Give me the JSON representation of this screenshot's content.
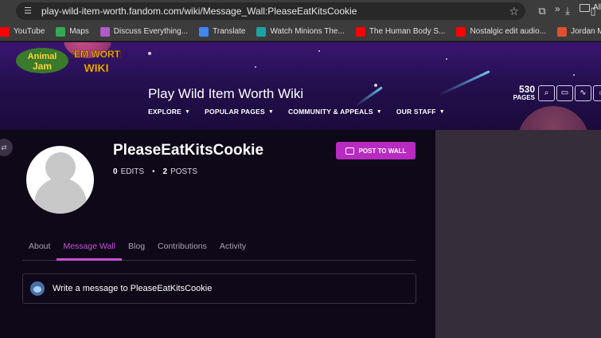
{
  "browser": {
    "url": "play-wild-item-worth.fandom.com/wiki/Message_Wall:PleaseEatKitsCookie",
    "bookmarks": [
      {
        "label": "YouTube",
        "color": "#ff0000"
      },
      {
        "label": "Maps",
        "color": "#34a853"
      },
      {
        "label": "Discuss Everything...",
        "color": "#b05cc8"
      },
      {
        "label": "Translate",
        "color": "#4285f4"
      },
      {
        "label": "Watch Minions The...",
        "color": "#1aa3a3"
      },
      {
        "label": "The Human Body S...",
        "color": "#ff0000"
      },
      {
        "label": "Nostalgic edit audio...",
        "color": "#ff0000"
      },
      {
        "label": "Jordan Marsh's Blue...",
        "color": "#e0502e"
      }
    ],
    "bookmarks_all": "All"
  },
  "wiki": {
    "title": "Play Wild Item Worth Wiki",
    "logo_text": "ITEM WORTH WIKI",
    "nav": [
      "EXPLORE",
      "POPULAR PAGES",
      "COMMUNITY & APPEALS",
      "OUR STAFF"
    ],
    "pages_count": "530",
    "pages_label": "PAGES"
  },
  "profile": {
    "username": "PleaseEatKitsCookie",
    "edits_count": "0",
    "edits_label": "EDITS",
    "posts_count": "2",
    "posts_label": "POSTS",
    "post_button": "POST TO WALL"
  },
  "tabs": [
    {
      "label": "About",
      "active": false
    },
    {
      "label": "Message Wall",
      "active": true
    },
    {
      "label": "Blog",
      "active": false
    },
    {
      "label": "Contributions",
      "active": false
    },
    {
      "label": "Activity",
      "active": false
    }
  ],
  "composer": {
    "placeholder": "Write a message to PleaseEatKitsCookie"
  },
  "colors": {
    "accent": "#b82bc0",
    "active_tab": "#c94fd8",
    "page_bg": "#0e0818",
    "rail_bg": "#362d3b"
  }
}
